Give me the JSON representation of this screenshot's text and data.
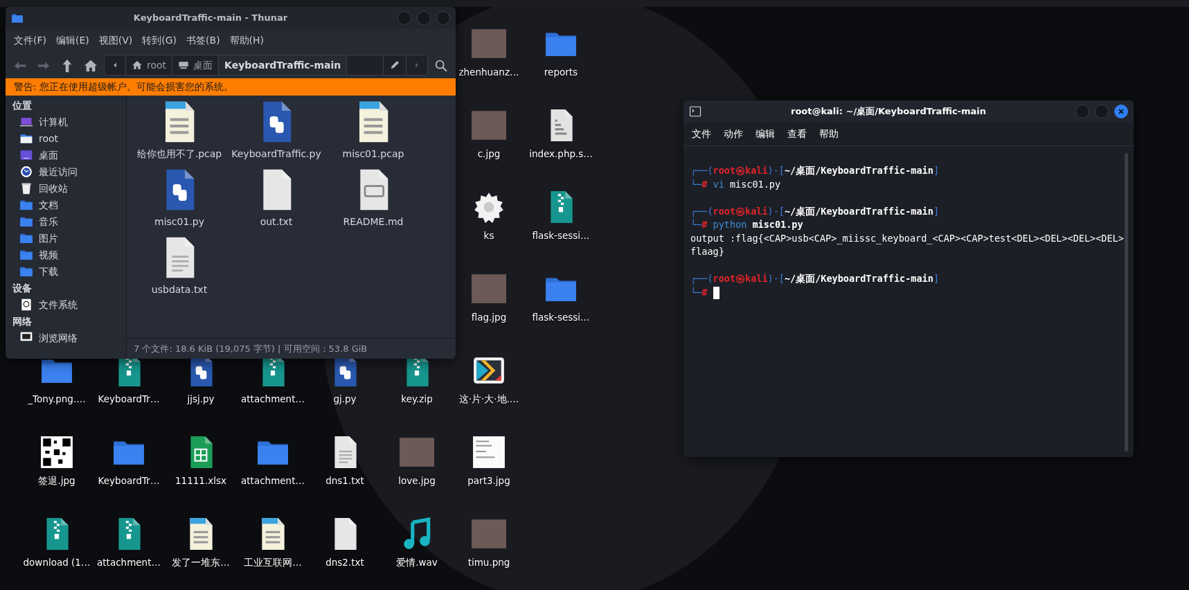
{
  "desktop": {
    "icons": [
      {
        "label": "zhenhuanz…",
        "kind": "photo"
      },
      {
        "label": "reports",
        "kind": "folder"
      },
      {
        "label": "c.jpg",
        "kind": "photo"
      },
      {
        "label": "index.php.s…",
        "kind": "script"
      },
      {
        "label": "ks",
        "kind": "gear"
      },
      {
        "label": "flask-sessi…",
        "kind": "zip"
      },
      {
        "label": "flag.jpg",
        "kind": "photo"
      },
      {
        "label": "flask-sessi…",
        "kind": "folder"
      },
      {
        "label": "_Tony.png.…",
        "kind": "folder"
      },
      {
        "label": "KeyboardTr…",
        "kind": "zip"
      },
      {
        "label": "jjsj.py",
        "kind": "python"
      },
      {
        "label": "attachment…",
        "kind": "zip"
      },
      {
        "label": "gj.py",
        "kind": "python"
      },
      {
        "label": "key.zip",
        "kind": "zip"
      },
      {
        "label": "这·片·大·地.…",
        "kind": "app"
      },
      {
        "label": "签退.jpg",
        "kind": "qr"
      },
      {
        "label": "KeyboardTr…",
        "kind": "folder"
      },
      {
        "label": "11111.xlsx",
        "kind": "sheet"
      },
      {
        "label": "attachment…",
        "kind": "folder"
      },
      {
        "label": "dns1.txt",
        "kind": "text"
      },
      {
        "label": "love.jpg",
        "kind": "photo"
      },
      {
        "label": "part3.jpg",
        "kind": "document"
      },
      {
        "label": "download (1…",
        "kind": "zip"
      },
      {
        "label": "attachment…",
        "kind": "zip"
      },
      {
        "label": "发了一堆东…",
        "kind": "binary"
      },
      {
        "label": "工业互联网…",
        "kind": "binary"
      },
      {
        "label": "dns2.txt",
        "kind": "blank"
      },
      {
        "label": "爱情.wav",
        "kind": "music"
      },
      {
        "label": "timu.png",
        "kind": "photo"
      }
    ]
  },
  "file_manager": {
    "title": "KeyboardTraffic-main - Thunar",
    "menu": [
      "文件(F)",
      "编辑(E)",
      "视图(V)",
      "转到(G)",
      "书签(B)",
      "帮助(H)"
    ],
    "nav_buttons": [
      {
        "kind": "back",
        "disabled": true
      },
      {
        "kind": "forward",
        "disabled": true
      },
      {
        "kind": "up",
        "disabled": false
      },
      {
        "kind": "home",
        "disabled": false
      }
    ],
    "breadcrumbs": [
      {
        "label": "root",
        "kind": "home",
        "selected": false
      },
      {
        "label": "桌面",
        "kind": "desktop",
        "selected": false
      },
      {
        "label": "KeyboardTraffic-main",
        "kind": "plain",
        "selected": true
      }
    ],
    "warning": "警告: 您正在使用超级帐户。可能会损害您的系统。",
    "sidebar": [
      {
        "heading": "位置",
        "items": [
          {
            "label": "计算机",
            "kind": "computer"
          },
          {
            "label": "root",
            "kind": "home"
          },
          {
            "label": "桌面",
            "kind": "desktop"
          },
          {
            "label": "最近访问",
            "kind": "recent"
          },
          {
            "label": "回收站",
            "kind": "trash"
          },
          {
            "label": "文档",
            "kind": "folder"
          },
          {
            "label": "音乐",
            "kind": "folder"
          },
          {
            "label": "图片",
            "kind": "folder"
          },
          {
            "label": "视频",
            "kind": "folder"
          },
          {
            "label": "下载",
            "kind": "folder"
          }
        ]
      },
      {
        "heading": "设备",
        "items": [
          {
            "label": "文件系统",
            "kind": "drive"
          }
        ]
      },
      {
        "heading": "网络",
        "items": [
          {
            "label": "浏览网络",
            "kind": "network"
          }
        ]
      }
    ],
    "files": [
      {
        "name": "给你也用不了.pcap",
        "kind": "binary"
      },
      {
        "name": "KeyboardTraffic.py",
        "kind": "python"
      },
      {
        "name": "misc01.pcap",
        "kind": "binary"
      },
      {
        "name": "misc01.py",
        "kind": "python"
      },
      {
        "name": "out.txt",
        "kind": "blank"
      },
      {
        "name": "README.md",
        "kind": "markdown"
      },
      {
        "name": "usbdata.txt",
        "kind": "text"
      }
    ],
    "status": "7 个文件: 18.6 KiB (19,075 字节) | 可用空间：53.8 GiB"
  },
  "terminal": {
    "title": "root@kali: ~/桌面/KeyboardTraffic-main",
    "menu": [
      "文件",
      "动作",
      "编辑",
      "查看",
      "帮助"
    ],
    "prompt_chars": {
      "open": "┌──(",
      "at": "㉿",
      "mid": ")-[",
      "close": "]",
      "corner": "└─",
      "symbol": "#"
    },
    "lines": [
      {
        "kind": "prompt",
        "user": "root",
        "host": "kali",
        "path": "~/桌面/KeyboardTraffic-main",
        "command": "vi",
        "args": "misc01.py",
        "args_bold": false,
        "cursor": false
      },
      {
        "kind": "blank"
      },
      {
        "kind": "prompt",
        "user": "root",
        "host": "kali",
        "path": "~/桌面/KeyboardTraffic-main",
        "command": "python",
        "args": "misc01.py",
        "args_bold": true,
        "cursor": false
      },
      {
        "kind": "output",
        "text": "output :flag{<CAP>usb<CAP>_miissc_keyboard_<CAP><CAP>test<DEL><DEL><DEL><DEL>"
      },
      {
        "kind": "output",
        "text": "flaag}"
      },
      {
        "kind": "blank"
      },
      {
        "kind": "prompt",
        "user": "root",
        "host": "kali",
        "path": "~/桌面/KeyboardTraffic-main",
        "cursor": true
      }
    ]
  }
}
